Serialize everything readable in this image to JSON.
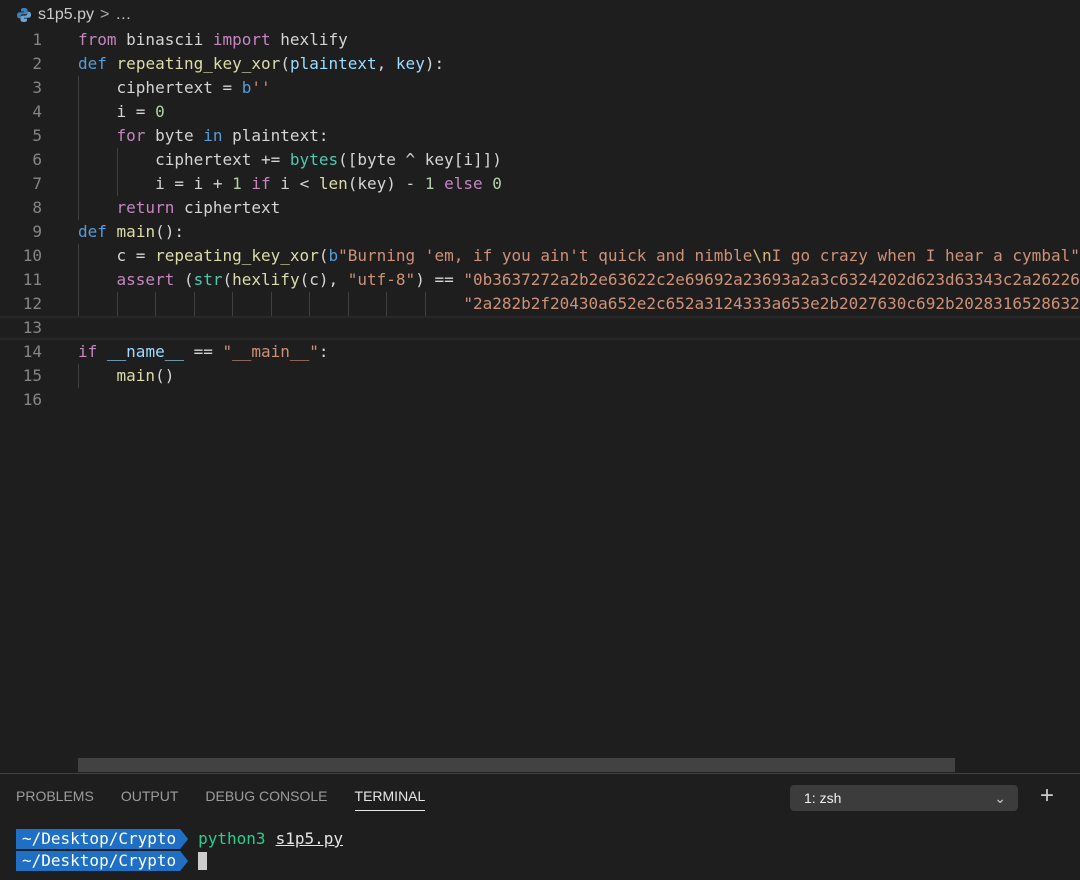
{
  "breadcrumb": {
    "file": "s1p5.py",
    "separator": ">",
    "more": "…"
  },
  "editor": {
    "lines": [
      {
        "num": "1",
        "indent": 0,
        "tokens": [
          [
            "k",
            "from"
          ],
          [
            "t",
            " binascii "
          ],
          [
            "k",
            "import"
          ],
          [
            "t",
            " hexlify"
          ]
        ]
      },
      {
        "num": "2",
        "indent": 0,
        "tokens": [
          [
            "d",
            "def"
          ],
          [
            "t",
            " "
          ],
          [
            "f",
            "repeating_key_xor"
          ],
          [
            "t",
            "("
          ],
          [
            "p",
            "plaintext"
          ],
          [
            "t",
            ", "
          ],
          [
            "p",
            "key"
          ],
          [
            "t",
            "):"
          ]
        ]
      },
      {
        "num": "3",
        "indent": 1,
        "tokens": [
          [
            "t",
            "    ciphertext = "
          ],
          [
            "d",
            "b"
          ],
          [
            "s",
            "''"
          ]
        ]
      },
      {
        "num": "4",
        "indent": 1,
        "tokens": [
          [
            "t",
            "    i = "
          ],
          [
            "n",
            "0"
          ]
        ]
      },
      {
        "num": "5",
        "indent": 1,
        "tokens": [
          [
            "t",
            "    "
          ],
          [
            "k",
            "for"
          ],
          [
            "t",
            " byte "
          ],
          [
            "d",
            "in"
          ],
          [
            "t",
            " plaintext:"
          ]
        ]
      },
      {
        "num": "6",
        "indent": 2,
        "tokens": [
          [
            "t",
            "        ciphertext += "
          ],
          [
            "b",
            "bytes"
          ],
          [
            "t",
            "([byte ^ key[i]])"
          ]
        ]
      },
      {
        "num": "7",
        "indent": 2,
        "tokens": [
          [
            "t",
            "        i = i + "
          ],
          [
            "n",
            "1"
          ],
          [
            "t",
            " "
          ],
          [
            "k",
            "if"
          ],
          [
            "t",
            " i < "
          ],
          [
            "f",
            "len"
          ],
          [
            "t",
            "(key) - "
          ],
          [
            "n",
            "1"
          ],
          [
            "t",
            " "
          ],
          [
            "k",
            "else"
          ],
          [
            "t",
            " "
          ],
          [
            "n",
            "0"
          ]
        ]
      },
      {
        "num": "8",
        "indent": 1,
        "tokens": [
          [
            "t",
            "    "
          ],
          [
            "k",
            "return"
          ],
          [
            "t",
            " ciphertext"
          ]
        ]
      },
      {
        "num": "9",
        "indent": 0,
        "tokens": [
          [
            "d",
            "def"
          ],
          [
            "t",
            " "
          ],
          [
            "f",
            "main"
          ],
          [
            "t",
            "():"
          ]
        ]
      },
      {
        "num": "10",
        "indent": 1,
        "tokens": [
          [
            "t",
            "    c = "
          ],
          [
            "f",
            "repeating_key_xor"
          ],
          [
            "t",
            "("
          ],
          [
            "d",
            "b"
          ],
          [
            "s",
            "\"Burning 'em, if you ain't quick and nimble"
          ],
          [
            "e",
            "\\n"
          ],
          [
            "s",
            "I go crazy when I hear a cymbal\""
          ]
        ]
      },
      {
        "num": "11",
        "indent": 1,
        "tokens": [
          [
            "t",
            "    "
          ],
          [
            "k",
            "assert"
          ],
          [
            "t",
            " ("
          ],
          [
            "b",
            "str"
          ],
          [
            "t",
            "("
          ],
          [
            "f",
            "hexlify"
          ],
          [
            "t",
            "(c), "
          ],
          [
            "s",
            "\"utf-8\""
          ],
          [
            "t",
            ") == "
          ],
          [
            "s",
            "\"0b3637272a2b2e63622c2e69692a23693a2a3c6324202d623d63343c2a26226"
          ]
        ]
      },
      {
        "num": "12",
        "indent": 10,
        "tokens": [
          [
            "t",
            "                                        "
          ],
          [
            "s",
            "\"2a282b2f20430a652e2c652a3124333a653e2b2027630c692b20283165286326"
          ]
        ]
      },
      {
        "num": "13",
        "indent": 0,
        "current": true,
        "tokens": []
      },
      {
        "num": "14",
        "indent": 0,
        "tokens": [
          [
            "k",
            "if"
          ],
          [
            "t",
            " "
          ],
          [
            "p",
            "__name__"
          ],
          [
            "t",
            " == "
          ],
          [
            "s",
            "\"__main__\""
          ],
          [
            "t",
            ":"
          ]
        ]
      },
      {
        "num": "15",
        "indent": 1,
        "tokens": [
          [
            "t",
            "    "
          ],
          [
            "f",
            "main"
          ],
          [
            "t",
            "()"
          ]
        ]
      },
      {
        "num": "16",
        "indent": 0,
        "tokens": []
      }
    ]
  },
  "panel": {
    "tabs": [
      {
        "label": "PROBLEMS"
      },
      {
        "label": "OUTPUT"
      },
      {
        "label": "DEBUG CONSOLE"
      },
      {
        "label": "TERMINAL",
        "active": true
      }
    ],
    "shell_select": "1: zsh",
    "chevron": "⌄",
    "add": "+"
  },
  "terminal": {
    "line1": {
      "prompt": "~/Desktop/Crypto",
      "command": "python3",
      "arg": "s1p5.py"
    },
    "line2": {
      "prompt": "~/Desktop/Crypto"
    }
  }
}
